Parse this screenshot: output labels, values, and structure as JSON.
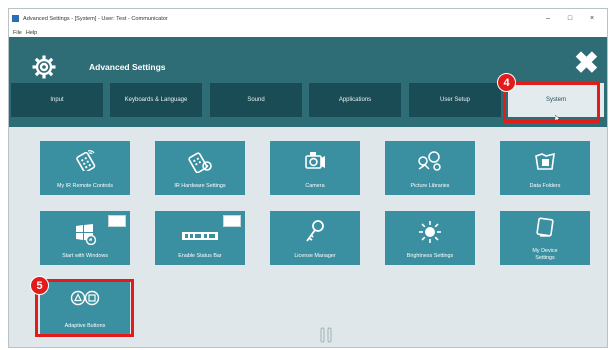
{
  "window": {
    "title": "Advanced Settings - [System] - User: Test - Communicator",
    "controls": {
      "minimize": "–",
      "maximize": "□",
      "close": "×"
    }
  },
  "menu": {
    "items": [
      "File",
      "Help"
    ]
  },
  "header": {
    "title": "Advanced Settings",
    "close_glyph": "✖"
  },
  "tabs": [
    {
      "label": "Input"
    },
    {
      "label": "Keyboards & Language"
    },
    {
      "label": "Sound"
    },
    {
      "label": "Applications"
    },
    {
      "label": "User Setup"
    },
    {
      "label": "System",
      "active": true
    }
  ],
  "tiles": [
    {
      "label": "My IR Remote Controls",
      "icon": "ir-remote-icon"
    },
    {
      "label": "IR Hardware Settings",
      "icon": "ir-hardware-icon"
    },
    {
      "label": "Camera",
      "icon": "camera-icon"
    },
    {
      "label": "Picture Libraries",
      "icon": "picture-libraries-icon"
    },
    {
      "label": "Data Folders",
      "icon": "data-folders-icon"
    },
    {
      "label": "Start with Windows",
      "icon": "windows-icon"
    },
    {
      "label": "Enable Status Bar",
      "icon": "status-bar-icon"
    },
    {
      "label": "License Manager",
      "icon": "key-icon"
    },
    {
      "label": "Brightness Settings",
      "icon": "brightness-icon"
    },
    {
      "label": "My Device Settings",
      "icon": "device-icon"
    },
    {
      "label": "Adaptive Buttons",
      "icon": "adaptive-buttons-icon"
    }
  ],
  "callouts": [
    {
      "number": "4"
    },
    {
      "number": "5"
    }
  ],
  "colors": {
    "header": "#2e6c76",
    "tab": "#1a4c55",
    "tile": "#3a8fa0",
    "background": "#dfe7ea",
    "callout": "#e21b1b"
  }
}
